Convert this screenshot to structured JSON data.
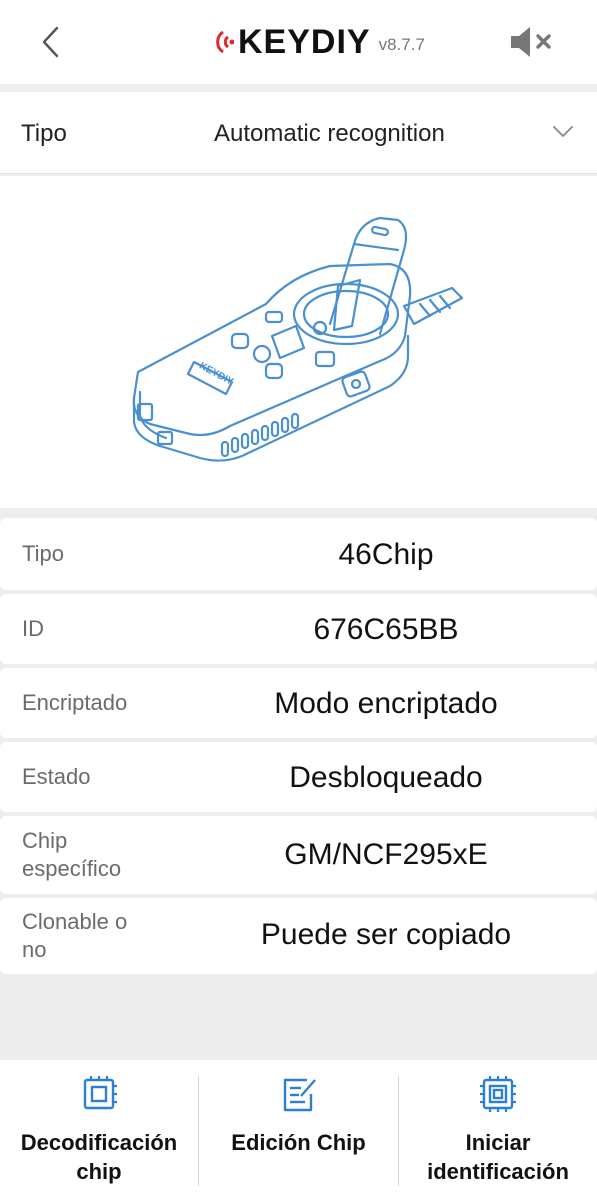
{
  "header": {
    "logo_text": "KEYDIY",
    "version": "v8.7.7",
    "back_icon": "chevron-left-icon",
    "mute_icon": "speaker-muted-icon"
  },
  "type_selector": {
    "label": "Tipo",
    "value": "Automatic recognition",
    "icon": "chevron-down-icon"
  },
  "illustration": {
    "device_brand": "KEYDIY"
  },
  "info": {
    "rows": [
      {
        "label": "Tipo",
        "value": "46Chip"
      },
      {
        "label": "ID",
        "value": "676C65BB"
      },
      {
        "label": "Encriptado",
        "value": "Modo encriptado"
      },
      {
        "label": "Estado",
        "value": "Desbloqueado"
      },
      {
        "label_line1": "Chip",
        "label_line2": "específico",
        "value": "GM/NCF295xE"
      },
      {
        "label_line1": "Clonable o",
        "label_line2": "no",
        "value": "Puede ser copiado"
      }
    ]
  },
  "bottom_nav": {
    "items": [
      {
        "line1": "Decodificación",
        "line2": "chip",
        "icon": "chip-icon"
      },
      {
        "line1": "Edición Chip",
        "icon": "edit-document-icon"
      },
      {
        "line1": "Iniciar",
        "line2": "identificación",
        "icon": "chip-scan-icon"
      }
    ]
  },
  "colors": {
    "accent": "#2b7fd4",
    "logo_red": "#e02a2a",
    "outline_blue": "#4a8fcf"
  }
}
